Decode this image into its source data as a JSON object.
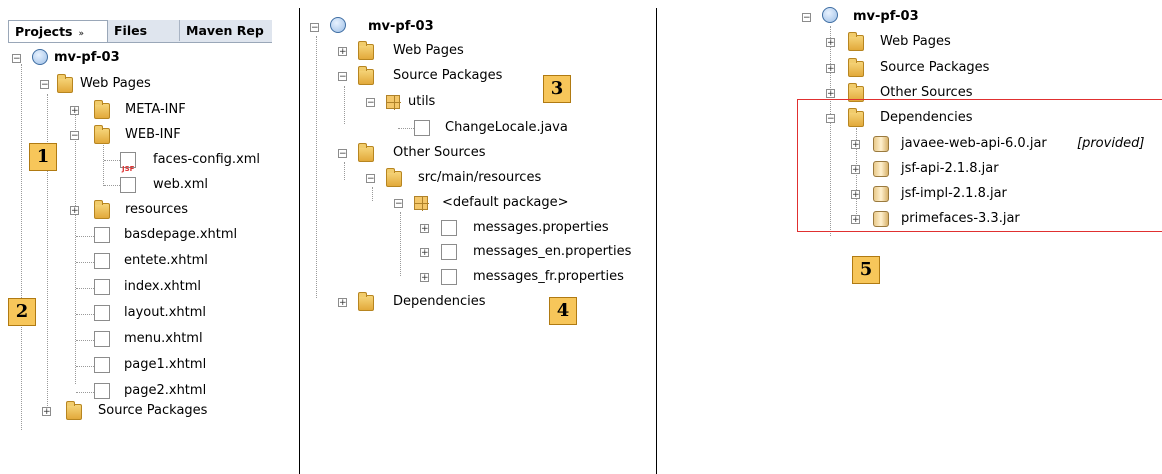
{
  "panel_left": {
    "tabs": [
      "Projects",
      "Files",
      "Maven Rep"
    ],
    "tab_close": "»",
    "project": "mv-pf-03",
    "web_pages": "Web Pages",
    "meta_inf": "META-INF",
    "web_inf": "WEB-INF",
    "faces_config": "faces-config.xml",
    "web_xml": "web.xml",
    "resources": "resources",
    "files": [
      "basdepage.xhtml",
      "entete.xhtml",
      "index.xhtml",
      "layout.xhtml",
      "menu.xhtml",
      "page1.xhtml",
      "page2.xhtml"
    ],
    "source_packages": "Source Packages",
    "jsf_tag": "JSF"
  },
  "panel_middle": {
    "project": "mv-pf-03",
    "web_pages": "Web Pages",
    "source_packages": "Source Packages",
    "utils": "utils",
    "change_locale": "ChangeLocale.java",
    "other_sources": "Other Sources",
    "src_main_resources": "src/main/resources",
    "default_package": "<default package>",
    "properties": [
      "messages.properties",
      "messages_en.properties",
      "messages_fr.properties"
    ],
    "dependencies": "Dependencies"
  },
  "panel_right": {
    "project": "mv-pf-03",
    "web_pages": "Web Pages",
    "source_packages": "Source Packages",
    "other_sources": "Other Sources",
    "dependencies": "Dependencies",
    "jars": [
      {
        "name": "javaee-web-api-6.0.jar",
        "tag": "[provided]"
      },
      {
        "name": "jsf-api-2.1.8.jar",
        "tag": ""
      },
      {
        "name": "jsf-impl-2.1.8.jar",
        "tag": ""
      },
      {
        "name": "primefaces-3.3.jar",
        "tag": ""
      }
    ]
  },
  "badges": [
    "1",
    "2",
    "3",
    "4",
    "5"
  ]
}
